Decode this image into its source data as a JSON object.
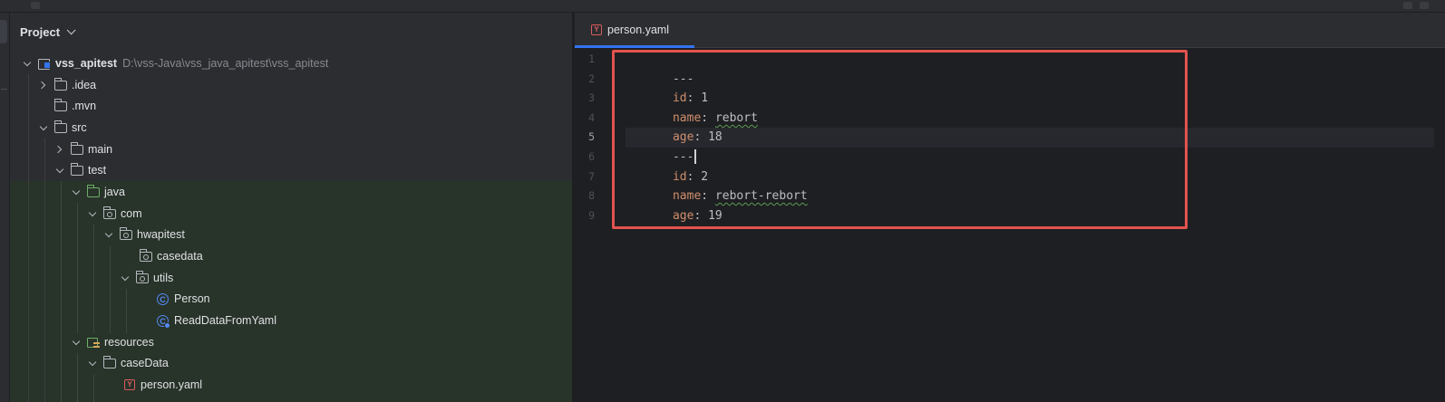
{
  "project_panel": {
    "title": "Project",
    "tree": [
      {
        "label": "vss_apitest",
        "path": "D:\\vss-Java\\vss_java_apitest\\vss_apitest"
      },
      {
        "label": ".idea"
      },
      {
        "label": ".mvn"
      },
      {
        "label": "src"
      },
      {
        "label": "main"
      },
      {
        "label": "test"
      },
      {
        "label": "java"
      },
      {
        "label": "com"
      },
      {
        "label": "hwapitest"
      },
      {
        "label": "casedata"
      },
      {
        "label": "utils"
      },
      {
        "label": "Person",
        "icon_letter": "C"
      },
      {
        "label": "ReadDataFromYaml",
        "icon_letter": "C"
      },
      {
        "label": "resources"
      },
      {
        "label": "caseData"
      },
      {
        "label": "person.yaml",
        "icon_letter": "Y"
      }
    ]
  },
  "editor": {
    "tabs": [
      {
        "label": "person.yaml",
        "icon_letter": "Y",
        "active": true
      }
    ],
    "lines": [
      {
        "num": "1",
        "key": "",
        "sep": "",
        "value": "---"
      },
      {
        "num": "2",
        "key": "id",
        "sep": ": ",
        "value": "1"
      },
      {
        "num": "3",
        "key": "name",
        "sep": ": ",
        "value": "rebort"
      },
      {
        "num": "4",
        "key": "age",
        "sep": ": ",
        "value": "18"
      },
      {
        "num": "5",
        "key": "",
        "sep": "",
        "value": "---"
      },
      {
        "num": "6",
        "key": "id",
        "sep": ": ",
        "value": "2"
      },
      {
        "num": "7",
        "key": "name",
        "sep": ": ",
        "value": "rebort-rebort"
      },
      {
        "num": "8",
        "key": "age",
        "sep": ": ",
        "value": "19"
      },
      {
        "num": "9",
        "key": "",
        "sep": "",
        "value": ""
      }
    ]
  },
  "colors": {
    "accent": "#3574f0",
    "annotation_border": "#e2534f",
    "yaml_key": "#cf8e6d",
    "test_folder_highlight": "#283329"
  }
}
